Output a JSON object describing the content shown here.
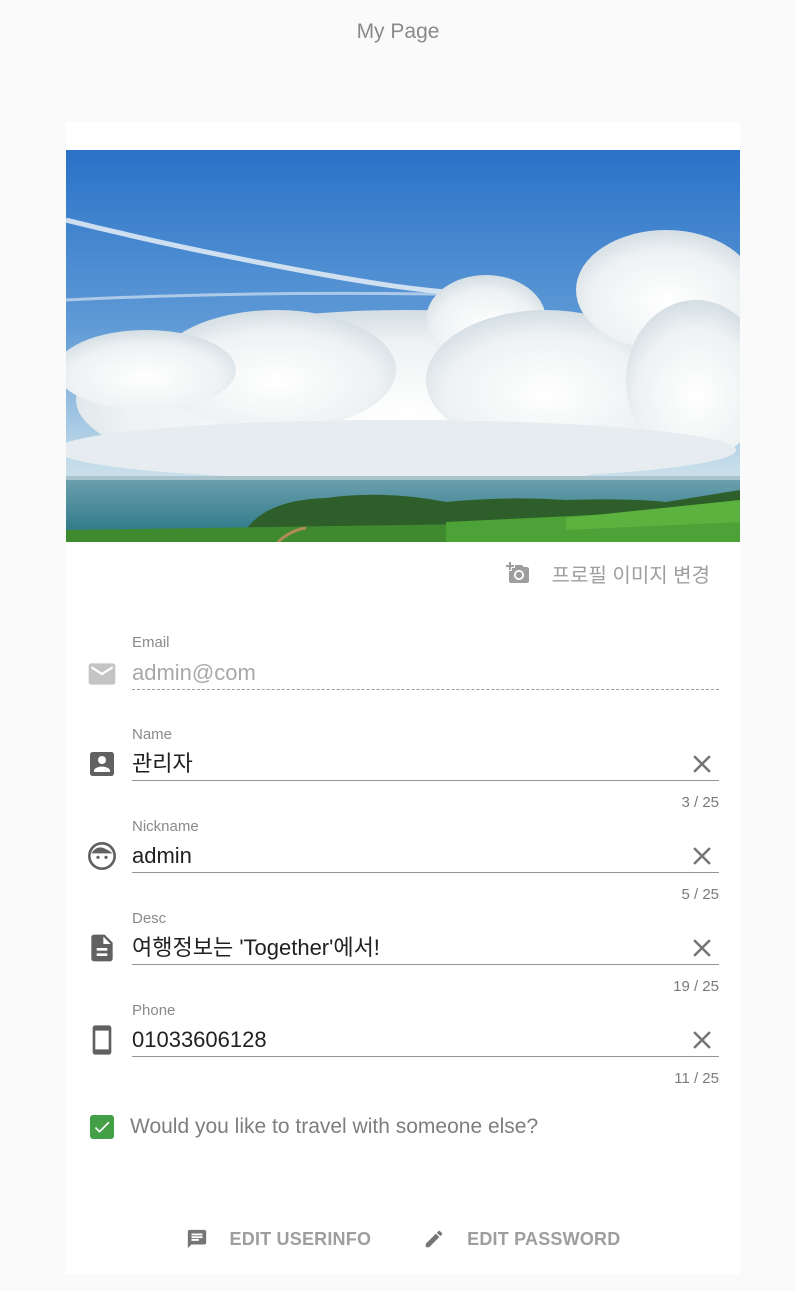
{
  "header": {
    "title": "My Page"
  },
  "profile": {
    "change_image_label": "프로필 이미지 변경"
  },
  "form": {
    "email": {
      "label": "Email",
      "value": "admin@com",
      "icon": "mail-icon"
    },
    "name": {
      "label": "Name",
      "value": "관리자",
      "counter": "3 / 25",
      "icon": "account-box-icon"
    },
    "nickname": {
      "label": "Nickname",
      "value": "admin",
      "counter": "5 / 25",
      "icon": "face-icon"
    },
    "desc": {
      "label": "Desc",
      "value": "여행정보는 'Together'에서!",
      "counter": "19 / 25",
      "icon": "document-icon"
    },
    "phone": {
      "label": "Phone",
      "value": "01033606128",
      "counter": "11 / 25",
      "icon": "phone-icon"
    },
    "travel_companion": {
      "label": "Would you like to travel with someone else?",
      "checked": true
    }
  },
  "actions": {
    "edit_userinfo": "EDIT USERINFO",
    "edit_password": "EDIT PASSWORD"
  },
  "colors": {
    "background": "#fafafa",
    "card": "#ffffff",
    "checkbox": "#43a047",
    "muted_text": "#9e9e9e"
  }
}
